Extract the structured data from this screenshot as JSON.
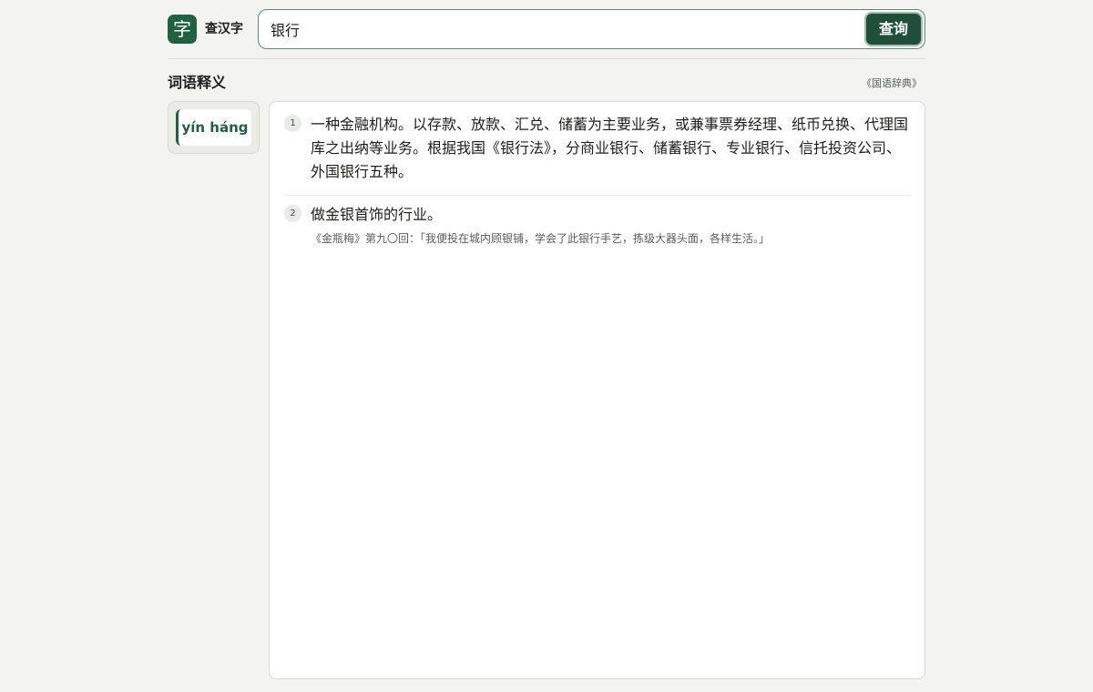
{
  "header": {
    "logo_char": "字",
    "brand": "查汉字",
    "search_value": "银行",
    "search_button": "查询"
  },
  "section": {
    "title": "词语释义",
    "source": "《国语辞典》"
  },
  "pinyin": {
    "tabs": [
      {
        "label": "yín háng"
      }
    ]
  },
  "definitions": [
    {
      "number": "1",
      "text": "一种金融机构。以存款、放款、汇兑、储蓄为主要业务，或兼事票券经理、纸币兑换、代理国库之出纳等业务。根据我国《银行法》，分商业银行、储蓄银行、专业银行、信托投资公司、外国银行五种。"
    },
    {
      "number": "2",
      "text": "做金银首饰的行业。",
      "example": "《金瓶梅》第九〇回：「我便投在城内顾银铺，学会了此银行手艺，拣级大器头面，各样生活。」"
    }
  ],
  "colors": {
    "accent": "#1f6140",
    "button": "#1f4f38",
    "background": "#f3f3ef"
  }
}
